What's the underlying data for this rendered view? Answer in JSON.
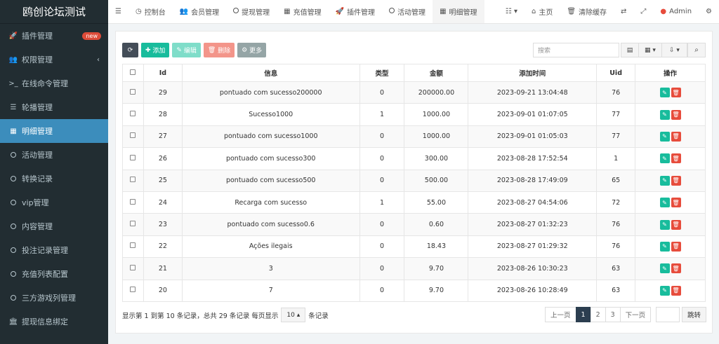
{
  "app": {
    "title": "鸥创论坛测试"
  },
  "sidebar": {
    "items": [
      {
        "label": "插件管理",
        "icon": "rocket-icon",
        "badge": "new"
      },
      {
        "label": "权限管理",
        "icon": "users-icon",
        "chevron": "‹"
      },
      {
        "label": "在线命令管理",
        "icon": "terminal-icon"
      },
      {
        "label": "轮播管理",
        "icon": "bars-icon"
      },
      {
        "label": "明细管理",
        "icon": "calendar-icon",
        "active": true
      },
      {
        "label": "活动管理",
        "icon": "circle-icon"
      },
      {
        "label": "转换记录",
        "icon": "circle-icon"
      },
      {
        "label": "vip管理",
        "icon": "circle-icon"
      },
      {
        "label": "内容管理",
        "icon": "circle-icon"
      },
      {
        "label": "投注记录管理",
        "icon": "circle-icon"
      },
      {
        "label": "充值列表配置",
        "icon": "circle-icon"
      },
      {
        "label": "三方游戏列管理",
        "icon": "circle-icon"
      },
      {
        "label": "提现信息绑定",
        "icon": "bank-icon"
      }
    ]
  },
  "topbar": {
    "tabs": [
      {
        "label": "控制台",
        "icon": "dashboard-icon"
      },
      {
        "label": "会员管理",
        "icon": "users-icon"
      },
      {
        "label": "提现管理",
        "icon": "circle-icon"
      },
      {
        "label": "充值管理",
        "icon": "grid-icon"
      },
      {
        "label": "插件管理",
        "icon": "rocket-icon"
      },
      {
        "label": "活动管理",
        "icon": "circle-icon"
      },
      {
        "label": "明细管理",
        "icon": "calendar-icon",
        "active": true
      }
    ],
    "right": {
      "home_label": "主页",
      "clear_cache_label": "清除缓存",
      "user_label": "Admin"
    }
  },
  "toolbar": {
    "add_label": "添加",
    "edit_label": "编辑",
    "delete_label": "删除",
    "more_label": "更多",
    "search_placeholder": "搜索"
  },
  "table": {
    "headers": [
      "Id",
      "信息",
      "类型",
      "金额",
      "添加时间",
      "Uid",
      "操作"
    ],
    "rows": [
      {
        "id": "29",
        "info": "pontuado com sucesso200000",
        "type": "0",
        "amount": "200000.00",
        "time": "2023-09-21 13:04:48",
        "uid": "76"
      },
      {
        "id": "28",
        "info": "Sucesso1000",
        "type": "1",
        "amount": "1000.00",
        "time": "2023-09-01 01:07:05",
        "uid": "77"
      },
      {
        "id": "27",
        "info": "pontuado com sucesso1000",
        "type": "0",
        "amount": "1000.00",
        "time": "2023-09-01 01:05:03",
        "uid": "77"
      },
      {
        "id": "26",
        "info": "pontuado com sucesso300",
        "type": "0",
        "amount": "300.00",
        "time": "2023-08-28 17:52:54",
        "uid": "1"
      },
      {
        "id": "25",
        "info": "pontuado com sucesso500",
        "type": "0",
        "amount": "500.00",
        "time": "2023-08-28 17:49:09",
        "uid": "65"
      },
      {
        "id": "24",
        "info": "Recarga com sucesso",
        "type": "1",
        "amount": "55.00",
        "time": "2023-08-27 04:54:06",
        "uid": "72"
      },
      {
        "id": "23",
        "info": "pontuado com sucesso0.6",
        "type": "0",
        "amount": "0.60",
        "time": "2023-08-27 01:32:23",
        "uid": "76"
      },
      {
        "id": "22",
        "info": "Ações ilegais",
        "type": "0",
        "amount": "18.43",
        "time": "2023-08-27 01:29:32",
        "uid": "76"
      },
      {
        "id": "21",
        "info": "3",
        "type": "0",
        "amount": "9.70",
        "time": "2023-08-26 10:30:23",
        "uid": "63"
      },
      {
        "id": "20",
        "info": "7",
        "type": "0",
        "amount": "9.70",
        "time": "2023-08-26 10:28:49",
        "uid": "63"
      }
    ]
  },
  "footer": {
    "info_prefix": "显示第 1 到第 10 条记录，总共 29 条记录 每页显示",
    "page_size": "10",
    "info_suffix": "条记录",
    "prev_label": "上一页",
    "pages": [
      "1",
      "2",
      "3"
    ],
    "current_page": "1",
    "next_label": "下一页",
    "jump_label": "跳转"
  },
  "colors": {
    "sidebar_bg": "#222d32",
    "sidebar_active": "#3c8dbc",
    "add_button": "#18bc9c",
    "delete_button": "#e74c3c",
    "pager_active": "#2c3e50"
  }
}
